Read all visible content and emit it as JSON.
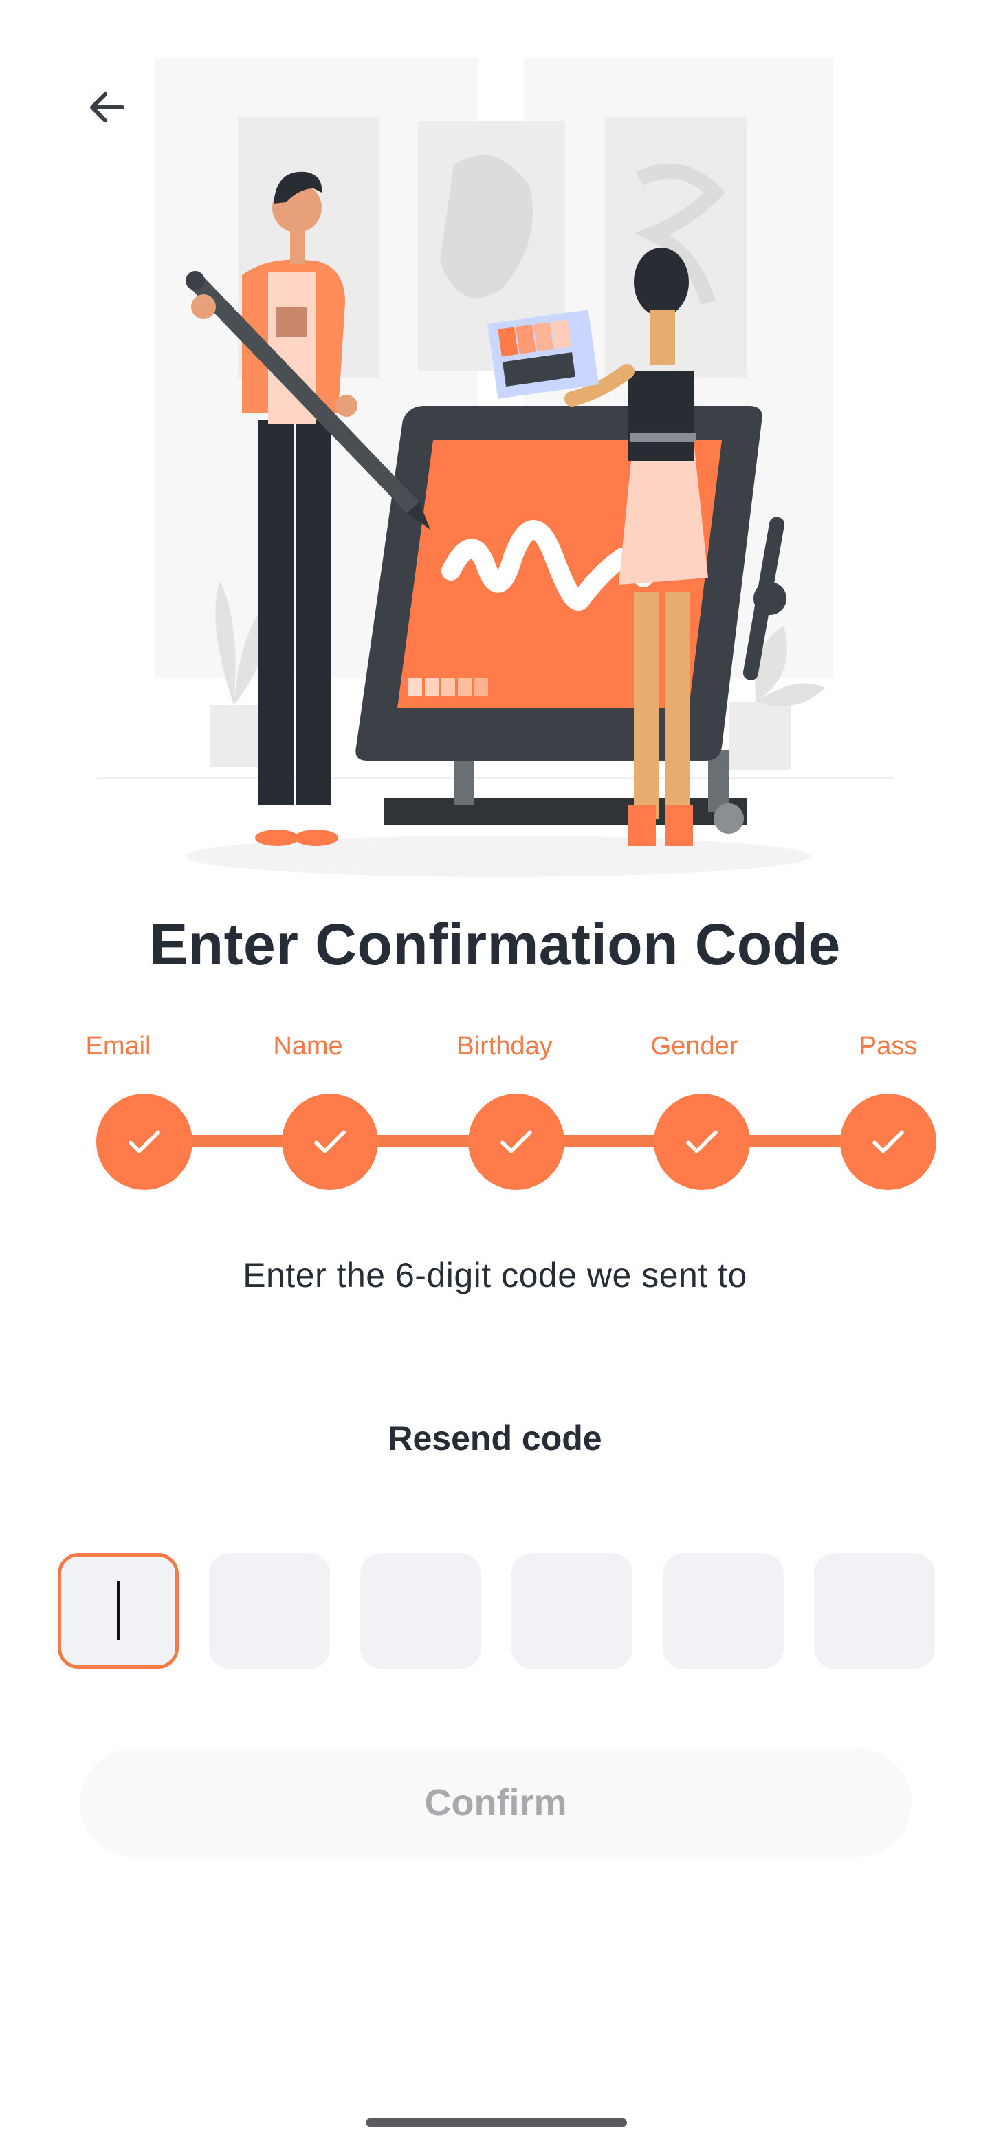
{
  "header": {
    "back_icon": "arrow-left-icon"
  },
  "illustration": {
    "name": "designers-with-drawing-tablet-illustration"
  },
  "title": "Enter Confirmation Code",
  "stepper": {
    "steps": [
      {
        "label": "Email",
        "completed": true
      },
      {
        "label": "Name",
        "completed": true
      },
      {
        "label": "Birthday",
        "completed": true
      },
      {
        "label": "Gender",
        "completed": true
      },
      {
        "label": "Pass",
        "completed": true
      }
    ]
  },
  "instructions": "Enter the 6-digit code we sent to",
  "resend_label": "Resend code",
  "code": {
    "digits": [
      "",
      "",
      "",
      "",
      "",
      ""
    ],
    "active_index": 0
  },
  "confirm_label": "Confirm",
  "colors": {
    "accent": "#f47a47",
    "text": "#272d36",
    "box": "#f1f2f6",
    "disabled_text": "#a7a9ad"
  }
}
